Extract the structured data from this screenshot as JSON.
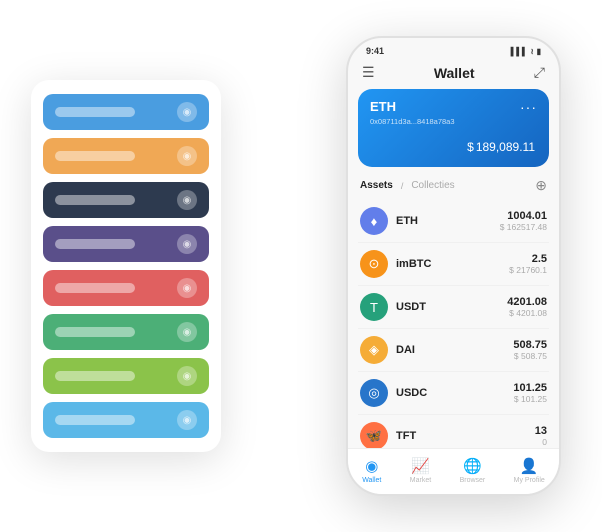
{
  "scene": {
    "cardList": {
      "rows": [
        {
          "color": "row-blue",
          "label": ""
        },
        {
          "color": "row-orange",
          "label": ""
        },
        {
          "color": "row-dark",
          "label": ""
        },
        {
          "color": "row-purple",
          "label": ""
        },
        {
          "color": "row-red",
          "label": ""
        },
        {
          "color": "row-green",
          "label": ""
        },
        {
          "color": "row-lime",
          "label": ""
        },
        {
          "color": "row-skyblue",
          "label": ""
        }
      ]
    },
    "phone": {
      "statusBar": {
        "time": "9:41",
        "signal": "▌▌▌",
        "wifi": "WiFi",
        "battery": "🔋"
      },
      "header": {
        "menuIcon": "☰",
        "title": "Wallet",
        "expandIcon": "⤢"
      },
      "walletCard": {
        "symbol": "ETH",
        "address": "0x08711d3a...8418a78a3",
        "balancePrefix": "$",
        "balance": "189,089.11"
      },
      "assetsSection": {
        "activeTab": "Assets",
        "divider": "/",
        "inactiveTab": "Collecties",
        "addIcon": "⊕"
      },
      "assets": [
        {
          "name": "ETH",
          "amount": "1004.01",
          "usd": "$ 162517.48",
          "icon": "♦",
          "iconBg": "#627eea",
          "iconColor": "#fff"
        },
        {
          "name": "imBTC",
          "amount": "2.5",
          "usd": "$ 21760.1",
          "icon": "⊙",
          "iconBg": "#f7931a",
          "iconColor": "#fff"
        },
        {
          "name": "USDT",
          "amount": "4201.08",
          "usd": "$ 4201.08",
          "icon": "T",
          "iconBg": "#26a17b",
          "iconColor": "#fff"
        },
        {
          "name": "DAI",
          "amount": "508.75",
          "usd": "$ 508.75",
          "icon": "◈",
          "iconBg": "#f5ac37",
          "iconColor": "#fff"
        },
        {
          "name": "USDC",
          "amount": "101.25",
          "usd": "$ 101.25",
          "icon": "◎",
          "iconBg": "#2775ca",
          "iconColor": "#fff"
        },
        {
          "name": "TFT",
          "amount": "13",
          "usd": "0",
          "icon": "🦋",
          "iconBg": "#ff7043",
          "iconColor": "#fff"
        }
      ],
      "navbar": [
        {
          "icon": "◉",
          "label": "Wallet",
          "active": true
        },
        {
          "icon": "📈",
          "label": "Market",
          "active": false
        },
        {
          "icon": "🌐",
          "label": "Browser",
          "active": false
        },
        {
          "icon": "👤",
          "label": "My Profile",
          "active": false
        }
      ]
    }
  }
}
